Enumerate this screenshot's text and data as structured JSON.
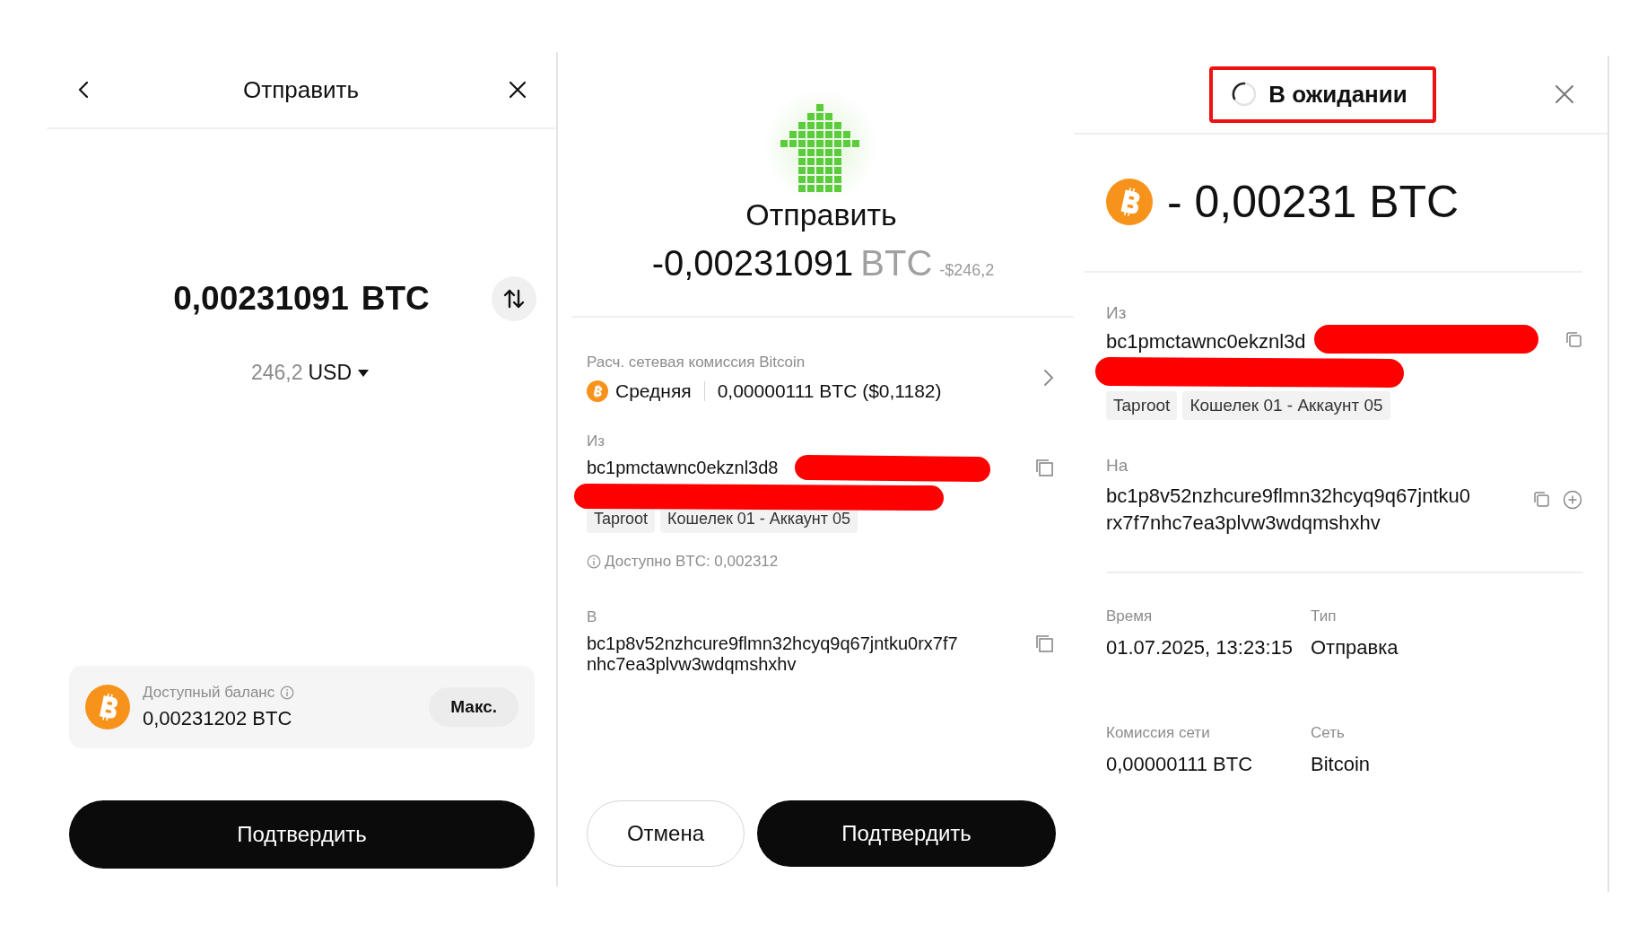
{
  "send_form": {
    "title": "Отправить",
    "amount": "0,00231091",
    "currency": "BTC",
    "fiat_amount": "246,2",
    "fiat_currency": "USD",
    "balance_label": "Доступный баланс",
    "balance": "0,00231202 BTC",
    "max_button": "Макс.",
    "confirm_button": "Подтвердить"
  },
  "review": {
    "title": "Отправить",
    "amount": "-0,00231091",
    "currency": "BTC",
    "fiat": "-$246,2",
    "fee_label": "Расч. сетевая комиссия Bitcoin",
    "fee_speed": "Средняя",
    "fee_amount": "0,00000111 BTC ($0,1182)",
    "from_label": "Из",
    "from_address": "bc1pmctawnc0ekznl3d8",
    "from_tags": [
      "Taproot",
      "Кошелек 01 - Аккаунт 05"
    ],
    "available": "Доступно BTC: 0,002312",
    "to_label": "В",
    "to_address": "bc1p8v52nzhcure9flmn32hcyq9q67jntku0rx7f7nhc7ea3plvw3wdqmshxhv",
    "cancel_button": "Отмена",
    "confirm_button": "Подтвердить"
  },
  "details": {
    "status": "В ожидании",
    "amount": "- 0,00231 BTC",
    "from_label": "Из",
    "from_address": "bc1pmctawnc0ekznl3d",
    "from_tags": [
      "Taproot",
      "Кошелек 01 - Аккаунт 05"
    ],
    "to_label": "На",
    "to_address": "bc1p8v52nzhcure9flmn32hcyq9q67jntku0rx7f7nhc7ea3plvw3wdqmshxhv",
    "fields": [
      {
        "label": "Время",
        "value": "01.07.2025, 13:23:15"
      },
      {
        "label": "Тип",
        "value": "Отправка"
      },
      {
        "label": "Комиссия сети",
        "value": "0,00000111 BTC"
      },
      {
        "label": "Сеть",
        "value": "Bitcoin"
      }
    ]
  }
}
